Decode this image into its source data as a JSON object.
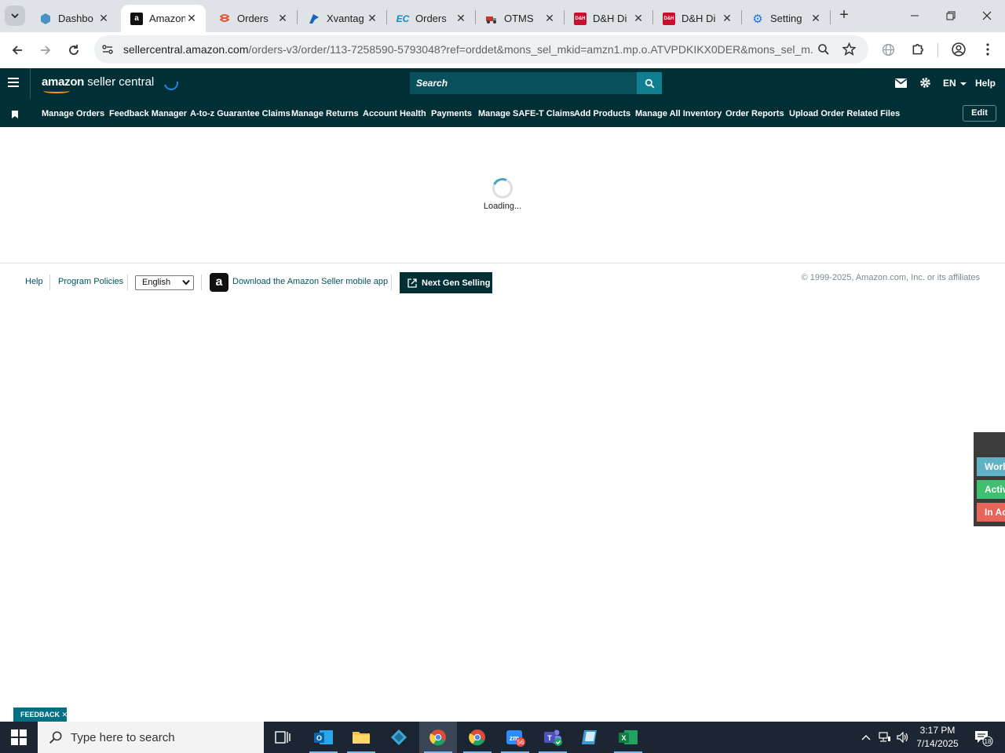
{
  "browser": {
    "tabs": [
      {
        "title": "Dashbo",
        "favicon": "hexagon-icon",
        "color": "#4a90c2",
        "active": false
      },
      {
        "title": "Amazon",
        "favicon": "amazon-icon",
        "color": "#111111",
        "active": true
      },
      {
        "title": "Orders",
        "favicon": "layers-icon",
        "color": "#e2552d",
        "active": false
      },
      {
        "title": "Xvantag",
        "favicon": "xvantage-icon",
        "color": "#1565c0",
        "active": false
      },
      {
        "title": "Orders",
        "favicon": "ec-icon",
        "color": "#0b8ec9",
        "active": false
      },
      {
        "title": "OTMS",
        "favicon": "truck-icon",
        "color": "#c0392b",
        "active": false
      },
      {
        "title": "D&H Di",
        "favicon": "dh-icon",
        "color": "#c8102e",
        "active": false
      },
      {
        "title": "D&H Di",
        "favicon": "dh-icon",
        "color": "#c8102e",
        "active": false
      },
      {
        "title": "Setting",
        "favicon": "gear-icon",
        "color": "#1a73e8",
        "active": false
      }
    ],
    "url_host": "sellercentral.amazon.com",
    "url_path": "/orders-v3/order/113-7258590-5793048?ref=orddet&mons_sel_mkid=amzn1.mp.o.ATVPDKIKX0DER&mons_sel_m..."
  },
  "header": {
    "logo_amazon": "amazon",
    "logo_rest": "seller central",
    "search_placeholder": "Search",
    "language": "EN",
    "help": "Help"
  },
  "nav": {
    "items": [
      "Manage Orders",
      "Feedback Manager",
      "A-to-z Guarantee Claims",
      "Manage Returns",
      "Account Health",
      "Payments",
      "Manage SAFE-T Claims",
      "Add Products",
      "Manage All Inventory",
      "Order Reports",
      "Upload Order Related Files"
    ],
    "edit": "Edit"
  },
  "main": {
    "loading": "Loading..."
  },
  "footer": {
    "help": "Help",
    "policies": "Program Policies",
    "language_selected": "English",
    "app_link": "Download the Amazon Seller mobile app",
    "next_gen": "Next Gen Selling",
    "copyright": "© 1999-2025, Amazon.com, Inc. or its affiliates"
  },
  "side_widget": {
    "items": [
      {
        "label": "Worl",
        "color": "#5fb3c4"
      },
      {
        "label": "Activ",
        "color": "#3fbf6f"
      },
      {
        "label": "In Ac",
        "color": "#e8655a"
      }
    ]
  },
  "feedback": "FEEDBACK",
  "taskbar": {
    "search_placeholder": "Type here to search",
    "time": "3:17 PM",
    "date": "7/14/2025",
    "notifications": "18",
    "zoom_badge": "56"
  }
}
